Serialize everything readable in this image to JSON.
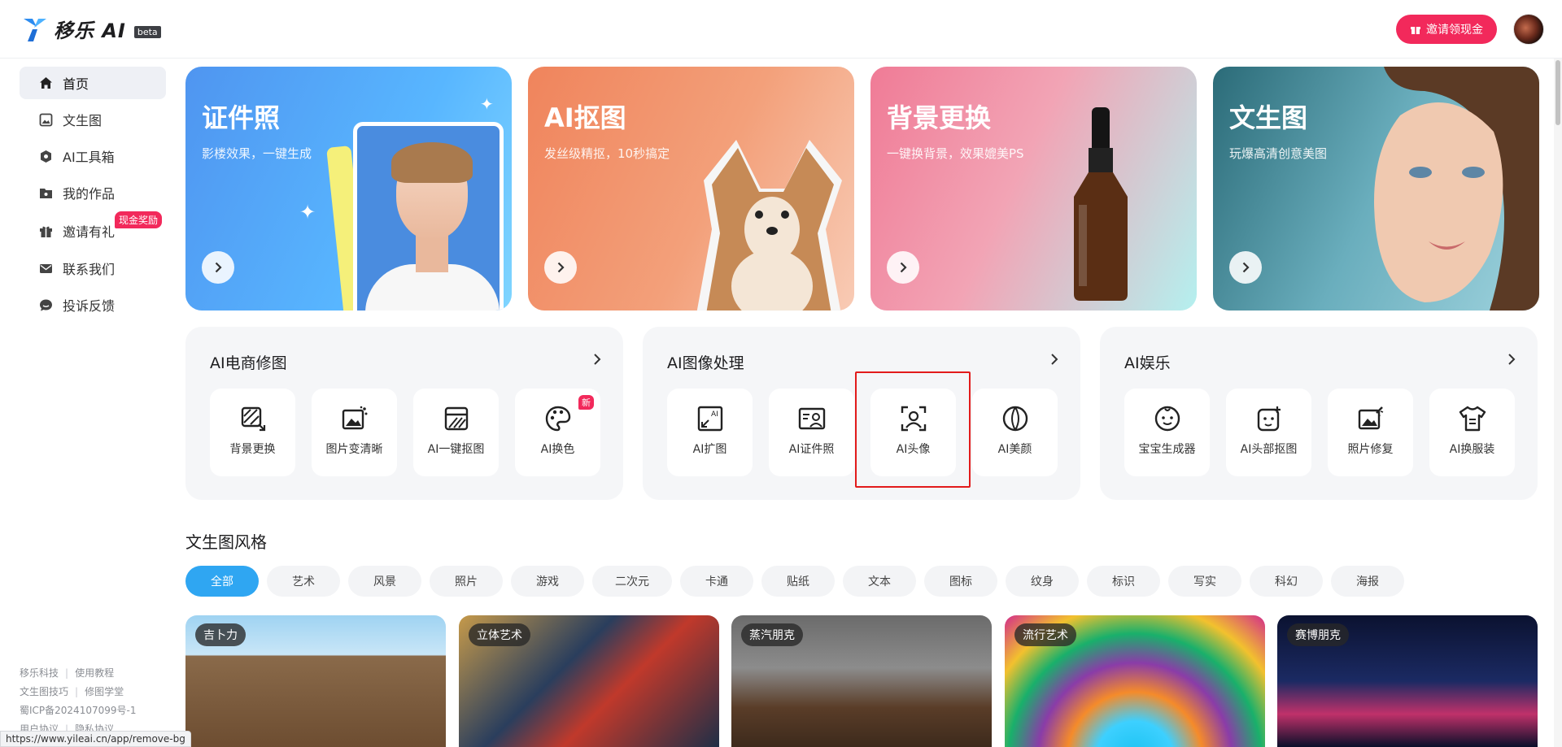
{
  "header": {
    "logo_text": "移乐 AI",
    "beta": "beta",
    "invite_button": "邀请领现金"
  },
  "sidebar": {
    "items": [
      {
        "label": "首页",
        "icon": "home-icon",
        "active": true
      },
      {
        "label": "文生图",
        "icon": "image-icon"
      },
      {
        "label": "AI工具箱",
        "icon": "toolbox-icon"
      },
      {
        "label": "我的作品",
        "icon": "folder-icon"
      },
      {
        "label": "邀请有礼",
        "icon": "gift-icon"
      },
      {
        "label": "联系我们",
        "icon": "mail-icon"
      },
      {
        "label": "投诉反馈",
        "icon": "feedback-icon"
      }
    ],
    "cash_badge": "现金奖励",
    "footer": {
      "company": "移乐科技",
      "tutorial": "使用教程",
      "tips": "文生图技巧",
      "school": "修图学堂",
      "icp": "蜀ICP备2024107099号-1",
      "terms": "用户协议",
      "privacy": "隐私协议"
    }
  },
  "banners": [
    {
      "title": "证件照",
      "subtitle": "影楼效果，一键生成"
    },
    {
      "title": "AI抠图",
      "subtitle": "发丝级精抠，10秒搞定"
    },
    {
      "title": "背景更换",
      "subtitle": "一键换背景，效果媲美PS"
    },
    {
      "title": "文生图",
      "subtitle": "玩爆高清创意美图"
    }
  ],
  "categories": [
    {
      "title": "AI电商修图",
      "tools": [
        {
          "label": "背景更换",
          "icon": "background-replace-icon"
        },
        {
          "label": "图片变清晰",
          "icon": "image-enhance-icon"
        },
        {
          "label": "AI一键抠图",
          "icon": "cutout-icon"
        },
        {
          "label": "AI换色",
          "icon": "palette-icon",
          "badge": "新"
        }
      ]
    },
    {
      "title": "AI图像处理",
      "tools": [
        {
          "label": "AI扩图",
          "icon": "expand-icon"
        },
        {
          "label": "AI证件照",
          "icon": "id-photo-icon"
        },
        {
          "label": "AI头像",
          "icon": "avatar-scan-icon"
        },
        {
          "label": "AI美颜",
          "icon": "beauty-icon"
        }
      ]
    },
    {
      "title": "AI娱乐",
      "tools": [
        {
          "label": "宝宝生成器",
          "icon": "baby-face-icon"
        },
        {
          "label": "AI头部抠图",
          "icon": "head-cutout-icon"
        },
        {
          "label": "照片修复",
          "icon": "photo-restore-icon"
        },
        {
          "label": "AI换服装",
          "icon": "shirt-icon"
        }
      ]
    }
  ],
  "styles_section": {
    "title": "文生图风格",
    "chips": [
      "全部",
      "艺术",
      "风景",
      "照片",
      "游戏",
      "二次元",
      "卡通",
      "贴纸",
      "文本",
      "图标",
      "纹身",
      "标识",
      "写实",
      "科幻",
      "海报"
    ],
    "active_chip": "全部",
    "thumbnails": [
      "吉卜力",
      "立体艺术",
      "蒸汽朋克",
      "流行艺术",
      "赛博朋克"
    ]
  },
  "status_url": "https://www.yileai.cn/app/remove-bg",
  "colors": {
    "accent": "#f2295b",
    "chip_active": "#2fa6f2",
    "highlight": "#e21b1b"
  }
}
